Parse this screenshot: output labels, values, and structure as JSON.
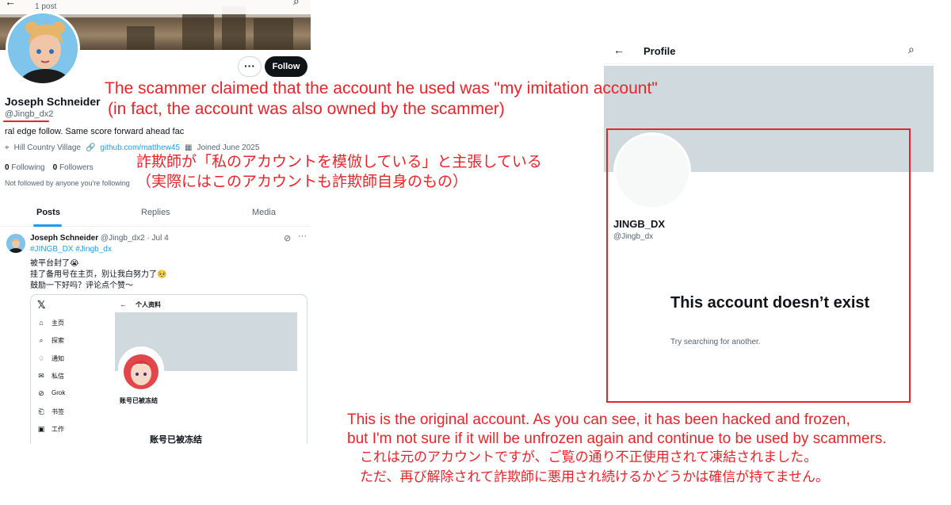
{
  "left_profile": {
    "post_count": "1 post",
    "display_name": "Joseph Schneider",
    "handle": "@Jingb_dx2",
    "follow_label": "Follow",
    "more_label": "···",
    "bio": "ral edge follow. Same score forward ahead fac",
    "location": "Hill Country Village",
    "website": "github.com/matthew45",
    "joined": "Joined June 2025",
    "following_count": "0",
    "following_label": "Following",
    "followers_count": "0",
    "followers_label": "Followers",
    "not_followed": "Not followed by anyone you're following",
    "tabs": [
      {
        "label": "Posts"
      },
      {
        "label": "Replies"
      },
      {
        "label": "Media"
      }
    ],
    "tweet": {
      "author": "Joseph Schneider",
      "meta": "@Jingb_dx2 · Jul 4",
      "hashtags": "#JINGB_DX #Jingb_dx",
      "lines": [
        "被平台封了😭",
        "挂了备用号在主页，别让我白努力了🥺",
        "鼓励一下好吗？评论点个赞～"
      ]
    },
    "embed": {
      "logo": "𝕏",
      "nav": [
        "主页",
        "探索",
        "通知",
        "私信",
        "Grok",
        "书签",
        "工作"
      ],
      "title": "个人资料",
      "frozen_small": "账号已被冻结",
      "frozen_big": "账号已被冻结"
    }
  },
  "right_profile": {
    "title": "Profile",
    "name": "JINGB_DX",
    "handle": "@Jingb_dx",
    "gone_title": "This account doesn’t exist",
    "gone_sub": "Try searching for another."
  },
  "annotations": {
    "en1": "The scammer claimed that the account he used was \"my imitation account\"",
    "en2": "(in fact, the account was also owned by the scammer)",
    "jp1": "詐欺師が「私のアカウントを模倣している」と主張している",
    "jp2": "（実際にはこのアカウントも詐欺師自身のもの）",
    "en3": "This is the original account. As you can see, it has been hacked and frozen,",
    "en4": "but I'm not sure if it will be unfrozen again and continue to be used by scammers.",
    "jp3": "これは元のアカウントですが、ご覧の通り不正使用されて凍結されました。",
    "jp4": "ただ、再び解除されて詐欺師に悪用され続けるかどうかは確信が持てません。"
  },
  "colors": {
    "annotation": "#e8242a",
    "link": "#1d9bf0",
    "follow_bg": "#0f1419"
  }
}
